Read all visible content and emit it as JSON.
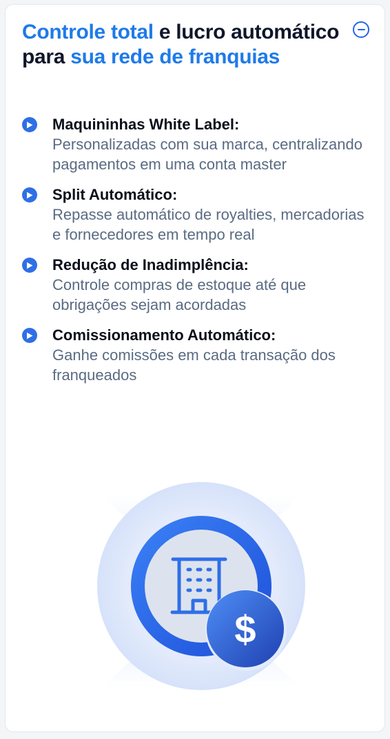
{
  "headline": {
    "part1": "Controle total",
    "part2": " e lucro automático para ",
    "part3": "sua rede de franquias"
  },
  "colors": {
    "accent": "#1f7ae8",
    "bullet": "#2f6fe6",
    "title": "#0b0f19",
    "description": "#5a6b82"
  },
  "features": [
    {
      "title": "Maquininhas White Label:",
      "description": "Personalizadas com sua marca, centralizando pagamentos em uma conta master"
    },
    {
      "title": "Split Automático:",
      "description": "Repasse automático de royalties, mercadorias e fornecedores em tempo real"
    },
    {
      "title": "Redução de Inadimplência:",
      "description": "Controle compras de estoque até que obrigações sejam acordadas"
    },
    {
      "title": "Comissionamento Automático:",
      "description": "Ganhe comissões em cada transação dos franqueados"
    }
  ],
  "illustration": {
    "icons": [
      "building-icon",
      "dollar-coin-icon"
    ],
    "coin_symbol": "$"
  }
}
